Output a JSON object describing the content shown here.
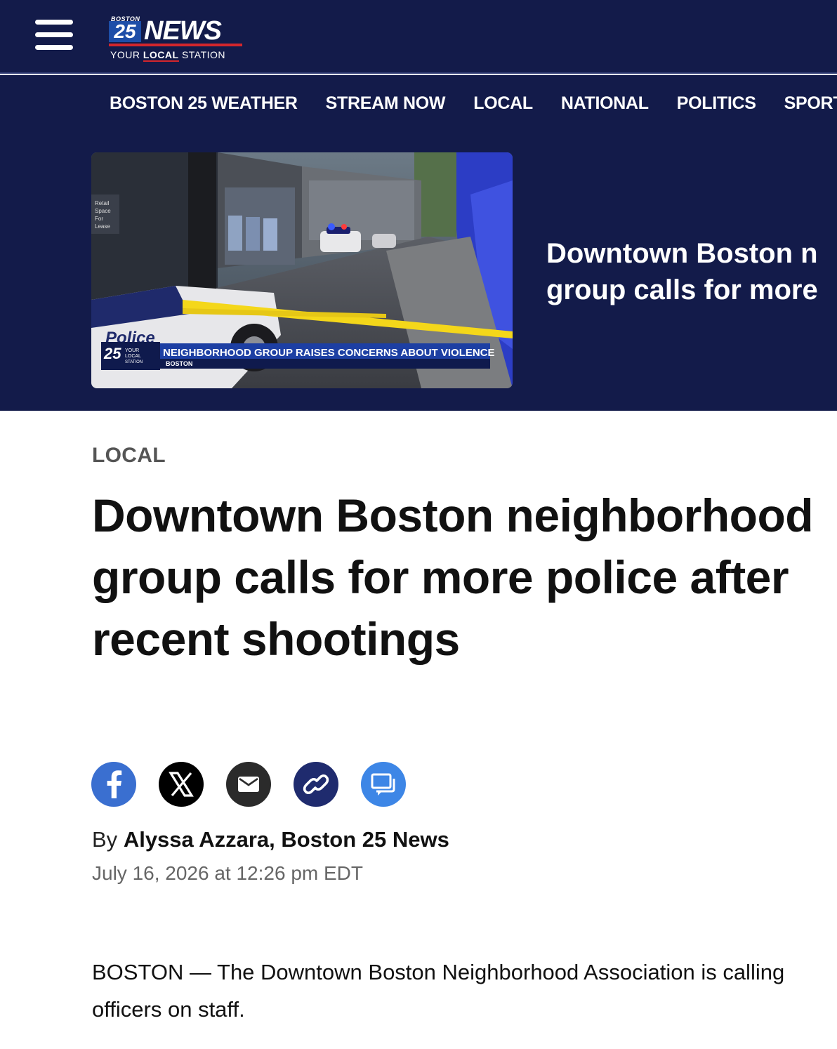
{
  "header": {
    "menu_icon": "hamburger-menu-icon",
    "logo": {
      "city": "BOSTON",
      "number": "25",
      "word": "NEWS",
      "tagline_pre": "YOUR",
      "tagline_bold": "LOCAL",
      "tagline_post": "STATION"
    }
  },
  "nav": {
    "items": [
      "BOSTON 25 WEATHER",
      "STREAM NOW",
      "LOCAL",
      "NATIONAL",
      "POLITICS",
      "SPORTS"
    ]
  },
  "hero": {
    "headline_line1": "Downtown Boston n",
    "headline_line2": "group calls for more",
    "image": {
      "chyron_title": "NEIGHBORHOOD GROUP RAISES CONCERNS ABOUT VIOLENCE",
      "chyron_location": "BOSTON",
      "sign_text": "Retail Space For Lease",
      "police_text": "Police"
    }
  },
  "article": {
    "section": "LOCAL",
    "headline": "Downtown Boston neighborhood group calls for more police after recent shootings",
    "share_icons": [
      "facebook-icon",
      "x-icon",
      "email-icon",
      "link-icon",
      "comment-icon"
    ],
    "byline_prefix": "By",
    "byline_author": "Alyssa Azzara, Boston 25 News",
    "timestamp": "July 16, 2026 at 12:26 pm EDT",
    "body_line1": "BOSTON — The Downtown Boston Neighborhood Association is calling",
    "body_line2": "officers on staff."
  },
  "colors": {
    "header_bg": "#131b4a",
    "brand_blue": "#1d4ea8",
    "brand_red": "#d4262c",
    "facebook": "#3a6fd0",
    "comment": "#3d86e6"
  }
}
